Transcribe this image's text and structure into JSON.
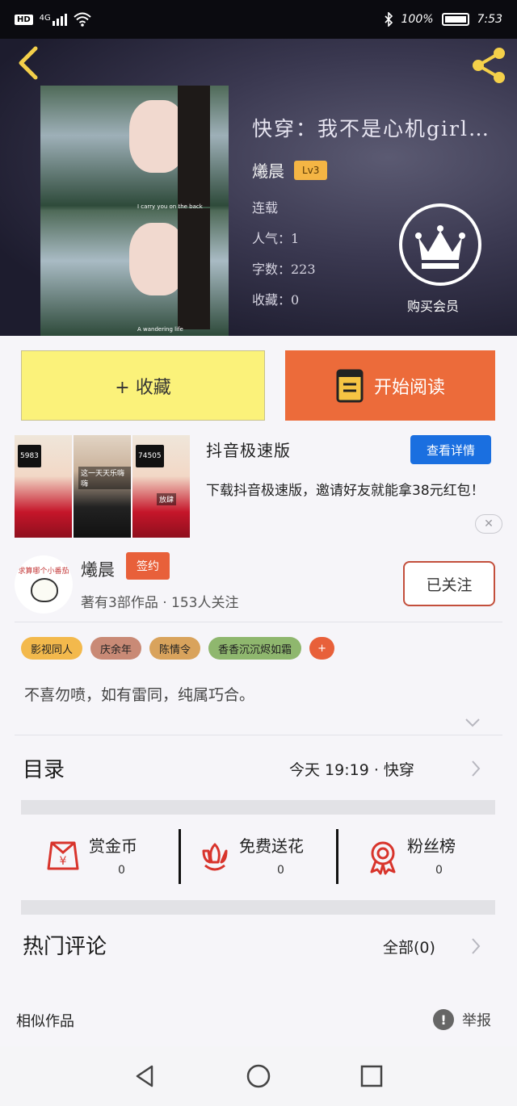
{
  "status_bar": {
    "left_badge": "HD",
    "network": "4G",
    "battery_percent": "100%",
    "time": "7:53"
  },
  "book": {
    "title": "快穿：我不是心机girl…",
    "author": "爔晨",
    "level": "Lv3",
    "status": "连载",
    "popularity": "人气：1",
    "words": "字数：223",
    "favorites": "收藏：0",
    "vip_label": "购买会员",
    "cover_caption_1": "I carry you on the back",
    "cover_caption_2": "A wandering life"
  },
  "actions": {
    "collect_label": "+ 收藏",
    "read_label": "开始阅读"
  },
  "ad": {
    "title": "抖音极速版",
    "detail_button": "查看详情",
    "description": "下载抖音极速版，邀请好友就能拿38元红包！",
    "thumb_counts": [
      "5983",
      "",
      "74505"
    ],
    "thumb_captions": [
      "",
      "这一天天乐嗨嗨",
      "放肆"
    ],
    "close_label": "✕"
  },
  "author_section": {
    "avatar_text": "求算哪个小番茄",
    "name": "爔晨",
    "sign_badge": "签约",
    "stats": "著有3部作品 · 153人关注",
    "follow_label": "已关注"
  },
  "tags": [
    {
      "label": "影视同人",
      "color": "#f3b94c"
    },
    {
      "label": "庆余年",
      "color": "#c98a76"
    },
    {
      "label": "陈情令",
      "color": "#d9a35c"
    },
    {
      "label": "香香沉沉烬如霜",
      "color": "#8fb76e"
    },
    {
      "label": "+",
      "color": "#e8603a"
    }
  ],
  "intro": "不喜勿喷，如有雷同，纯属巧合。",
  "catalog": {
    "title": "目录",
    "info": "今天  19:19  ·  快穿"
  },
  "rewards": [
    {
      "label": "赏金币",
      "value": "0",
      "icon": "red-envelope-icon"
    },
    {
      "label": "免费送花",
      "value": "0",
      "icon": "flower-icon"
    },
    {
      "label": "粉丝榜",
      "value": "0",
      "icon": "medal-icon"
    }
  ],
  "comments": {
    "title": "热门评论",
    "all_label": "全部(0)"
  },
  "similar": {
    "title": "相似作品",
    "report_label": "举报"
  },
  "colors": {
    "accent_orange": "#ec6b3a",
    "accent_yellow": "#fbf27a",
    "ad_blue": "#1a6fe0",
    "icon_red": "#d8342c"
  }
}
